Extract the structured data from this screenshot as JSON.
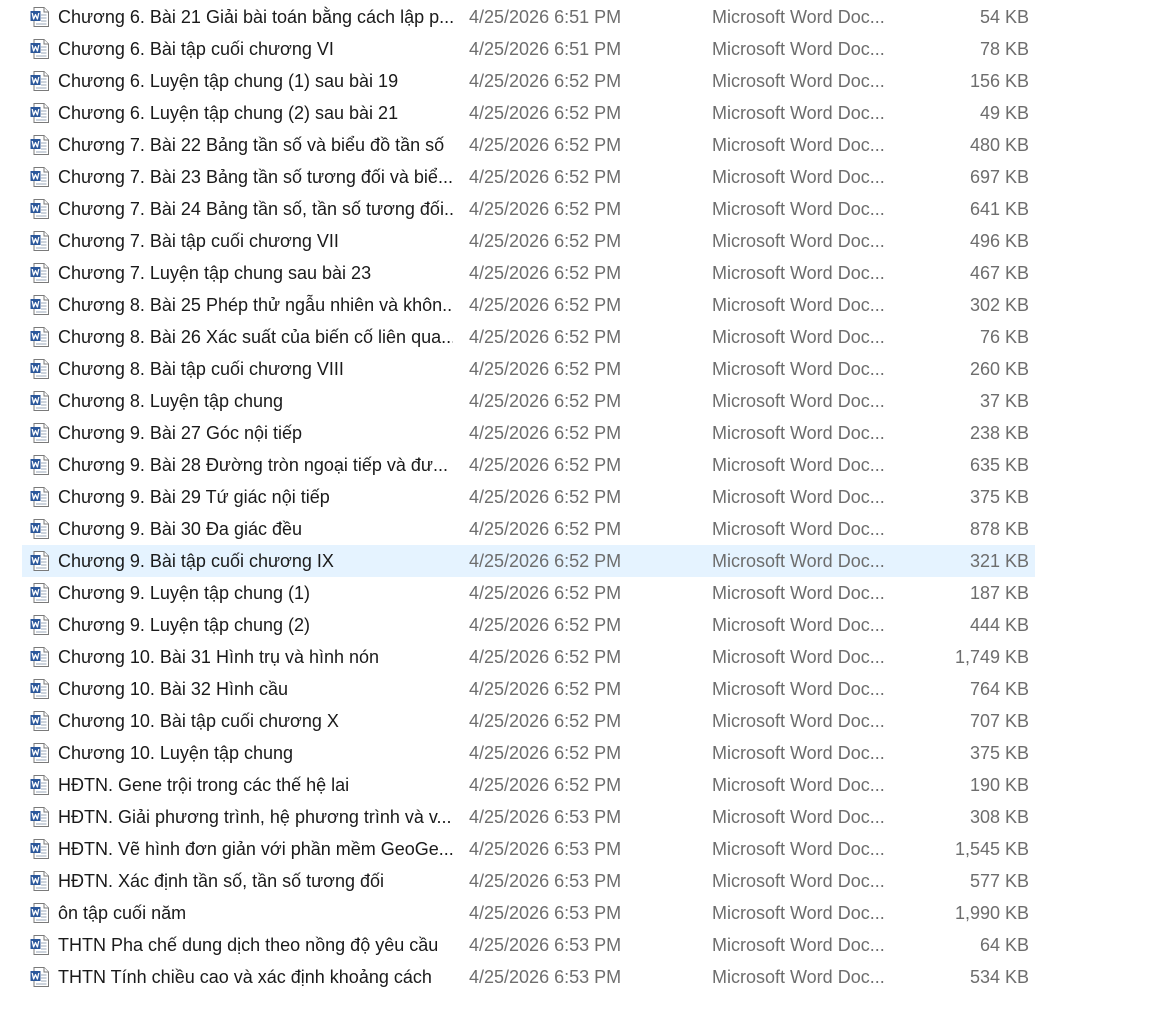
{
  "colors": {
    "selected_row_bg": "#e5f3ff",
    "name_text": "#1a1a1a",
    "detail_text": "#6d6d6d",
    "word_icon_blue": "#2b579a"
  },
  "icon": "word-document-icon",
  "selected_index": 17,
  "files": [
    {
      "name": "Chương 6. Bài 21 Giải bài toán bằng cách lập p...",
      "date": "4/25/2026 6:51 PM",
      "type": "Microsoft Word Doc...",
      "size": "54 KB"
    },
    {
      "name": "Chương 6. Bài tập cuối chương VI",
      "date": "4/25/2026 6:51 PM",
      "type": "Microsoft Word Doc...",
      "size": "78 KB"
    },
    {
      "name": "Chương 6. Luyện tập chung (1) sau bài 19",
      "date": "4/25/2026 6:52 PM",
      "type": "Microsoft Word Doc...",
      "size": "156 KB"
    },
    {
      "name": "Chương 6. Luyện tập chung (2) sau bài 21",
      "date": "4/25/2026 6:52 PM",
      "type": "Microsoft Word Doc...",
      "size": "49 KB"
    },
    {
      "name": "Chương 7. Bài 22 Bảng tần số và biểu đồ tần số",
      "date": "4/25/2026 6:52 PM",
      "type": "Microsoft Word Doc...",
      "size": "480 KB"
    },
    {
      "name": "Chương 7. Bài 23 Bảng tần số tương đối và biể...",
      "date": "4/25/2026 6:52 PM",
      "type": "Microsoft Word Doc...",
      "size": "697 KB"
    },
    {
      "name": "Chương 7. Bài 24 Bảng tần số, tần số tương đối...",
      "date": "4/25/2026 6:52 PM",
      "type": "Microsoft Word Doc...",
      "size": "641 KB"
    },
    {
      "name": "Chương 7. Bài tập cuối chương VII",
      "date": "4/25/2026 6:52 PM",
      "type": "Microsoft Word Doc...",
      "size": "496 KB"
    },
    {
      "name": "Chương 7. Luyện tập chung sau bài 23",
      "date": "4/25/2026 6:52 PM",
      "type": "Microsoft Word Doc...",
      "size": "467 KB"
    },
    {
      "name": "Chương 8. Bài 25 Phép thử ngẫu nhiên và khôn...",
      "date": "4/25/2026 6:52 PM",
      "type": "Microsoft Word Doc...",
      "size": "302 KB"
    },
    {
      "name": "Chương 8. Bài 26 Xác suất của biến cố liên qua...",
      "date": "4/25/2026 6:52 PM",
      "type": "Microsoft Word Doc...",
      "size": "76 KB"
    },
    {
      "name": "Chương 8. Bài tập cuối chương VIII",
      "date": "4/25/2026 6:52 PM",
      "type": "Microsoft Word Doc...",
      "size": "260 KB"
    },
    {
      "name": "Chương 8. Luyện tập chung",
      "date": "4/25/2026 6:52 PM",
      "type": "Microsoft Word Doc...",
      "size": "37 KB"
    },
    {
      "name": "Chương 9. Bài 27 Góc nội tiếp",
      "date": "4/25/2026 6:52 PM",
      "type": "Microsoft Word Doc...",
      "size": "238 KB"
    },
    {
      "name": "Chương 9. Bài 28 Đường tròn ngoại tiếp và đư...",
      "date": "4/25/2026 6:52 PM",
      "type": "Microsoft Word Doc...",
      "size": "635 KB"
    },
    {
      "name": "Chương 9. Bài 29 Tứ giác nội tiếp",
      "date": "4/25/2026 6:52 PM",
      "type": "Microsoft Word Doc...",
      "size": "375 KB"
    },
    {
      "name": "Chương 9. Bài 30 Đa giác đều",
      "date": "4/25/2026 6:52 PM",
      "type": "Microsoft Word Doc...",
      "size": "878 KB"
    },
    {
      "name": "Chương 9. Bài tập cuối chương IX",
      "date": "4/25/2026 6:52 PM",
      "type": "Microsoft Word Doc...",
      "size": "321 KB"
    },
    {
      "name": "Chương 9. Luyện tập chung (1)",
      "date": "4/25/2026 6:52 PM",
      "type": "Microsoft Word Doc...",
      "size": "187 KB"
    },
    {
      "name": "Chương 9. Luyện tập chung (2)",
      "date": "4/25/2026 6:52 PM",
      "type": "Microsoft Word Doc...",
      "size": "444 KB"
    },
    {
      "name": "Chương 10. Bài 31 Hình trụ và hình nón",
      "date": "4/25/2026 6:52 PM",
      "type": "Microsoft Word Doc...",
      "size": "1,749 KB"
    },
    {
      "name": "Chương 10. Bài 32 Hình cầu",
      "date": "4/25/2026 6:52 PM",
      "type": "Microsoft Word Doc...",
      "size": "764 KB"
    },
    {
      "name": "Chương 10. Bài tập cuối chương X",
      "date": "4/25/2026 6:52 PM",
      "type": "Microsoft Word Doc...",
      "size": "707 KB"
    },
    {
      "name": "Chương 10. Luyện tập chung",
      "date": "4/25/2026 6:52 PM",
      "type": "Microsoft Word Doc...",
      "size": "375 KB"
    },
    {
      "name": "HĐTN. Gene trội trong các thế hệ lai",
      "date": "4/25/2026 6:52 PM",
      "type": "Microsoft Word Doc...",
      "size": "190 KB"
    },
    {
      "name": "HĐTN. Giải phương trình, hệ phương trình và v...",
      "date": "4/25/2026 6:53 PM",
      "type": "Microsoft Word Doc...",
      "size": "308 KB"
    },
    {
      "name": "HĐTN. Vẽ hình đơn giản với phần mềm GeoGe...",
      "date": "4/25/2026 6:53 PM",
      "type": "Microsoft Word Doc...",
      "size": "1,545 KB"
    },
    {
      "name": "HĐTN. Xác định tần số, tần số tương đối",
      "date": "4/25/2026 6:53 PM",
      "type": "Microsoft Word Doc...",
      "size": "577 KB"
    },
    {
      "name": "ôn tập cuối năm",
      "date": "4/25/2026 6:53 PM",
      "type": "Microsoft Word Doc...",
      "size": "1,990 KB"
    },
    {
      "name": "THTN Pha chế dung dịch theo nồng độ yêu cầu",
      "date": "4/25/2026 6:53 PM",
      "type": "Microsoft Word Doc...",
      "size": "64 KB"
    },
    {
      "name": "THTN Tính chiều cao và xác định khoảng cách",
      "date": "4/25/2026 6:53 PM",
      "type": "Microsoft Word Doc...",
      "size": "534 KB"
    }
  ]
}
